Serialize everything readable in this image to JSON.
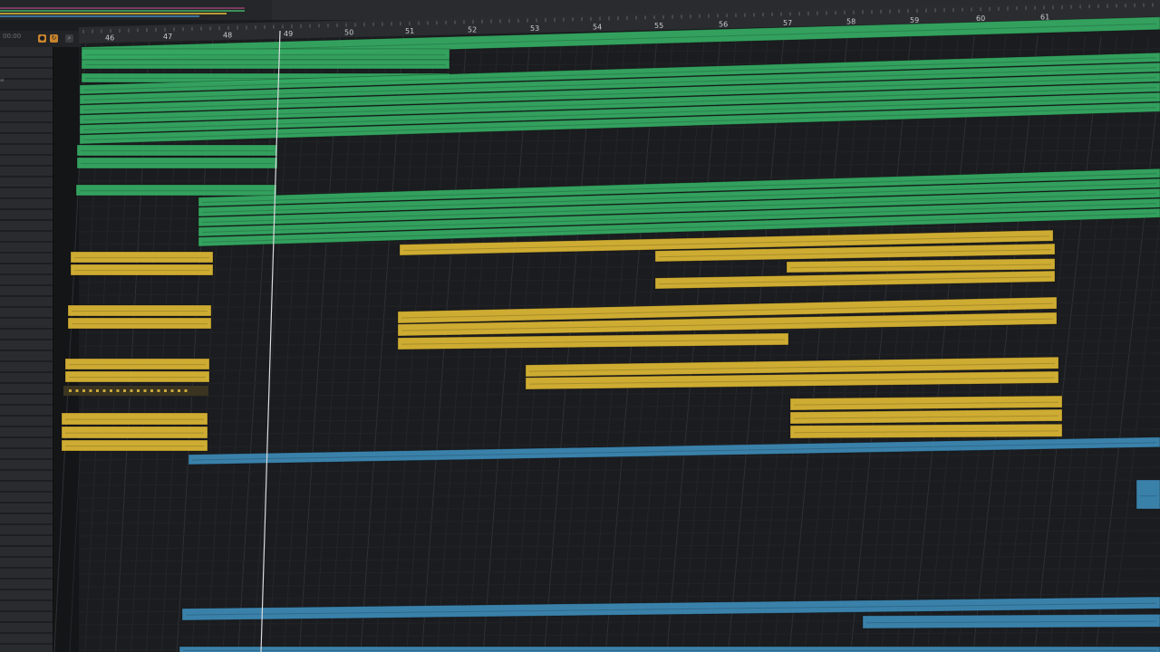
{
  "window": {
    "bar_counter": "00:00"
  },
  "ruler": {
    "bar_numbers": [
      "46",
      "47",
      "48",
      "49",
      "50",
      "51",
      "52",
      "53",
      "54",
      "55",
      "56",
      "57",
      "58",
      "59",
      "60",
      "61"
    ]
  },
  "playhead": {
    "bar": "49"
  },
  "track_list": {
    "partial_label": "al"
  },
  "colors": {
    "green_region": "#35a862",
    "yellow_region": "#d8b434",
    "blue_region": "#3c87b2",
    "background": "#1b1c1f",
    "ruler": "#2b2c30"
  },
  "icons": {
    "toolbar_buttons": [
      "record-icon",
      "loop-icon",
      "search-icon"
    ]
  }
}
